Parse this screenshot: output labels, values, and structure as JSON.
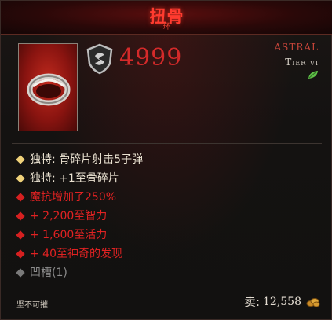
{
  "item": {
    "name": "扭骨",
    "type": "环",
    "rarity": "ASTRAL",
    "tier": "Tier vi",
    "armor": "4999"
  },
  "affixes": [
    {
      "kind": "unique",
      "text": "独特: 骨碎片射击5子弹"
    },
    {
      "kind": "unique",
      "text": "独特: +1至骨碎片"
    },
    {
      "kind": "magic",
      "text": "魔抗增加了250%"
    },
    {
      "kind": "magic",
      "text": "+ 2,200至智力"
    },
    {
      "kind": "magic",
      "text": "+ 1,600至活力"
    },
    {
      "kind": "magic",
      "text": "+ 40至神奇的发现"
    },
    {
      "kind": "socket",
      "text": "凹槽(1)"
    }
  ],
  "footer": {
    "flag": "坚不可摧",
    "sell_label": "卖:",
    "sell_value": "12,558"
  },
  "icons": {
    "armor": "armor-shield-icon",
    "tier": "leaf-icon",
    "gold": "gold-coins-icon",
    "item": "ring-icon"
  },
  "colors": {
    "title": "#ff3b2f",
    "rarity": "#c8453a",
    "unique_bullet": "#f0d27a",
    "magic": "#e02222",
    "socket": "#8c8c8c"
  }
}
